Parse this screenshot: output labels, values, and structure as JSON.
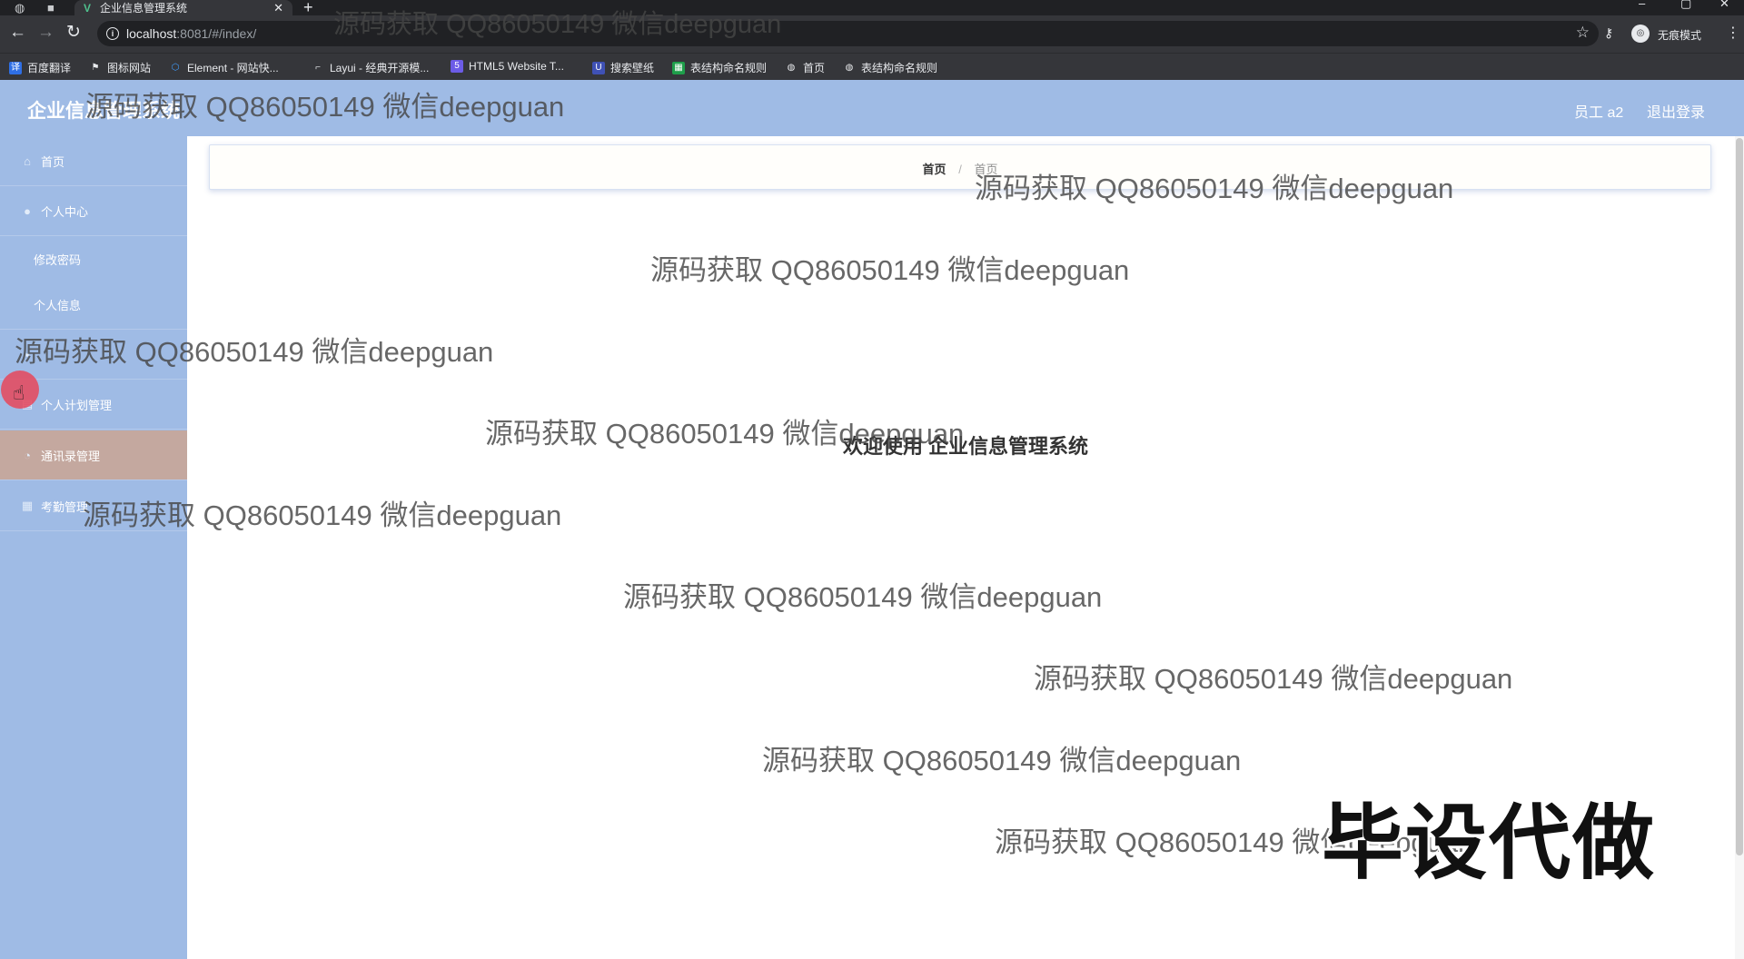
{
  "browser": {
    "tab_title": "企业信息管理系统",
    "url_host": "localhost",
    "url_rest": ":8081/#/index/",
    "profile_label": "无痕模式",
    "bookmarks": [
      {
        "label": "百度翻译",
        "icon": "baidu-translate-icon",
        "color": "#2f6fe4"
      },
      {
        "label": "图标网站",
        "icon": "flag-icon",
        "color": "#e8eaed"
      },
      {
        "label": "Element - 网站快...",
        "icon": "element-icon",
        "color": "#409eff"
      },
      {
        "label": "Layui - 经典开源模...",
        "icon": "layui-icon",
        "color": "#e8eaed"
      },
      {
        "label": "HTML5 Website T...",
        "icon": "html5-icon",
        "color": "#6c5ce7"
      },
      {
        "label": "搜索壁纸",
        "icon": "search-wallpaper-icon",
        "color": "#3f51b5"
      },
      {
        "label": "表结构命名规则",
        "icon": "sheet-icon",
        "color": "#1e9e4a"
      },
      {
        "label": "首页",
        "icon": "globe-icon",
        "color": "#e8eaed"
      },
      {
        "label": "表结构命名规则",
        "icon": "globe-icon",
        "color": "#e8eaed"
      }
    ]
  },
  "app": {
    "title": "企业信息管理系统",
    "user_label": "员工 a2",
    "logout_label": "退出登录",
    "accent_color": "#9fbbe5"
  },
  "sidebar": {
    "items": [
      {
        "label": "首页",
        "icon": "home-icon",
        "type": "top"
      },
      {
        "label": "个人中心",
        "icon": "user-icon",
        "type": "top"
      },
      {
        "label": "修改密码",
        "type": "sub"
      },
      {
        "label": "个人信息",
        "type": "sub"
      },
      {
        "label": "",
        "type": "top",
        "icon": "menu-icon"
      },
      {
        "label": "个人计划管理",
        "icon": "plan-icon",
        "type": "top"
      },
      {
        "label": "通讯录管理",
        "icon": "contacts-icon",
        "type": "top",
        "active": true
      },
      {
        "label": "考勤管理",
        "icon": "grid-icon",
        "type": "top"
      }
    ]
  },
  "main": {
    "breadcrumb_home": "首页",
    "breadcrumb_sep": "/",
    "breadcrumb_current": "首页",
    "welcome": "欢迎使用 企业信息管理系统"
  },
  "overlays": {
    "watermark": "源码获取 QQ86050149 微信deepguan",
    "big_text": "毕设代做"
  }
}
